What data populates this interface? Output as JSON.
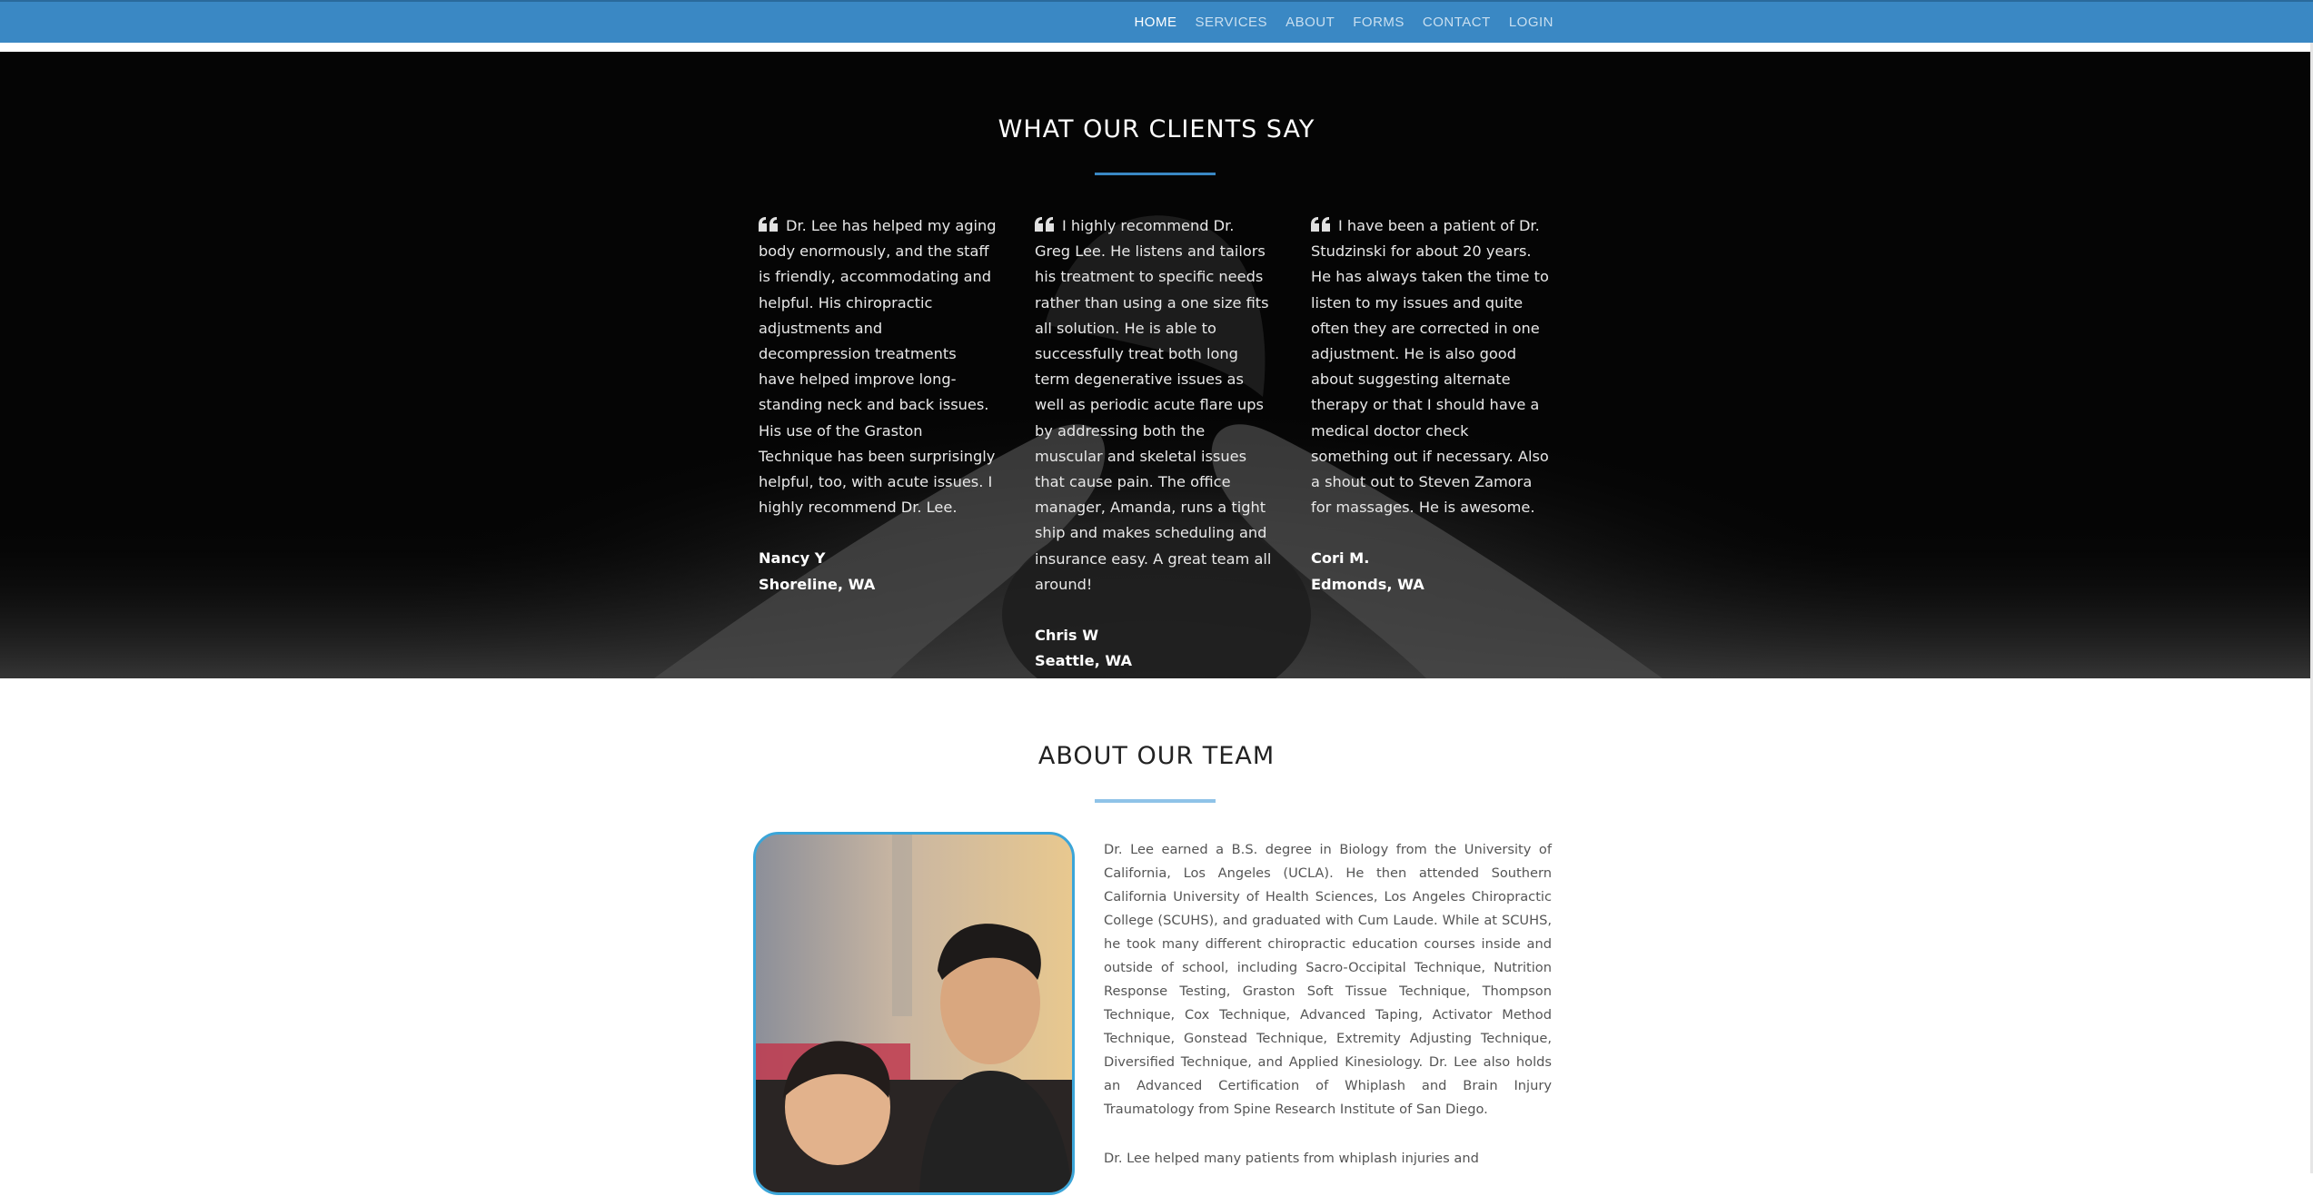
{
  "nav": {
    "items": [
      {
        "label": "HOME",
        "active": true
      },
      {
        "label": "SERVICES",
        "active": false
      },
      {
        "label": "ABOUT",
        "active": false
      },
      {
        "label": "FORMS",
        "active": false
      },
      {
        "label": "CONTACT",
        "active": false
      },
      {
        "label": "LOGIN",
        "active": false
      }
    ]
  },
  "testimonials": {
    "title": "WHAT OUR CLIENTS SAY",
    "quotes": [
      {
        "text": "Dr. Lee has helped my aging body enormously, and the staff is friendly, accommodating and helpful. His chiropractic adjustments and decompression treatments have helped improve long-standing neck and back issues. His use of the Graston Technique has been surprisingly helpful, too, with acute issues. I highly recommend Dr. Lee.",
        "name": "Nancy Y",
        "location": "Shoreline, WA"
      },
      {
        "text": "I highly recommend Dr. Greg Lee. He listens and tailors his treatment to specific needs rather than using a one size fits all solution. He is able to successfully treat both long term degenerative issues as well as periodic acute flare ups by addressing both the muscular and skeletal issues that cause pain. The office manager, Amanda, runs a tight ship and makes scheduling and insurance easy. A great team all around!",
        "name": "Chris W",
        "location": "Seattle, WA"
      },
      {
        "text": "I have been a patient of Dr. Studzinski for about 20 years. He has always taken the time to listen to my issues and quite often they are corrected in one adjustment. He is also good about suggesting alternate therapy or that I should have a medical doctor check something out if necessary. Also a shout out to Steven Zamora for massages. He is awesome.",
        "name": "Cori M.",
        "location": "Edmonds, WA"
      }
    ]
  },
  "about": {
    "title": "ABOUT OUR TEAM",
    "paragraphs": [
      "Dr. Lee earned a B.S. degree in Biology from the University of California, Los Angeles (UCLA). He then attended Southern California University of Health Sciences, Los Angeles Chiropractic College (SCUHS), and graduated with Cum Laude. While at SCUHS, he took many different chiropractic education courses inside and outside of school, including Sacro-Occipital Technique, Nutrition Response Testing, Graston Soft Tissue Technique, Thompson Technique, Cox Technique, Advanced Taping, Activator Method Technique, Gonstead Technique, Extremity Adjusting Technique, Diversified Technique, and Applied Kinesiology. Dr. Lee also holds an Advanced Certification of Whiplash and Brain Injury Traumatology from Spine Research Institute of San Diego.",
      "Dr. Lee helped many patients from whiplash injuries and"
    ]
  },
  "colors": {
    "nav_bg": "#3a88c4",
    "accent_rule": "#3a88c4",
    "photo_border": "#3ba5d8"
  },
  "icons": [
    "quote-left-icon"
  ]
}
